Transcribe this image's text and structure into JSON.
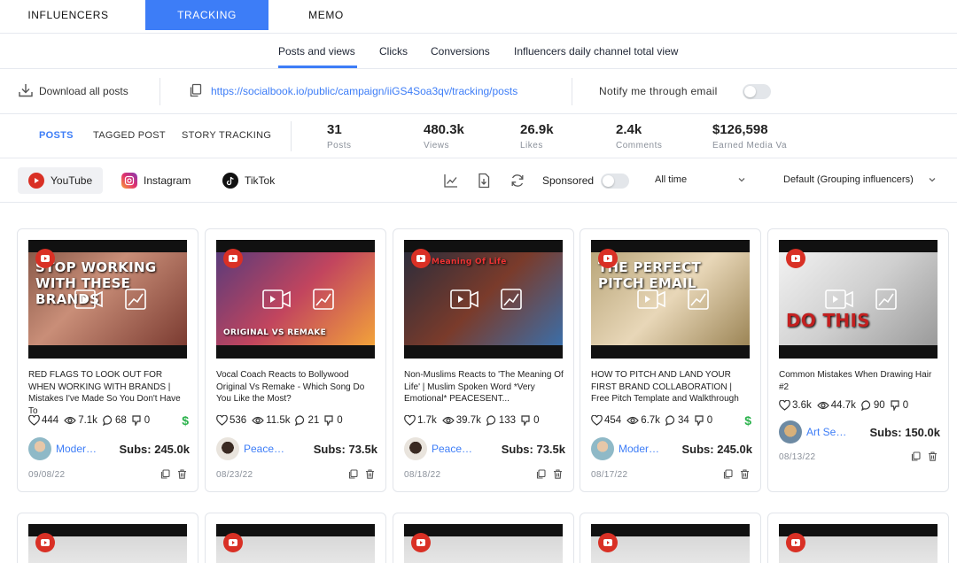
{
  "top_tabs": [
    "INFLUENCERS",
    "TRACKING",
    "MEMO"
  ],
  "sub_tabs": [
    "Posts and views",
    "Clicks",
    "Conversions",
    "Influencers daily channel total view"
  ],
  "link_row": {
    "download_label": "Download all posts",
    "url": "https://socialbook.io/public/campaign/iiGS4Soa3qv/tracking/posts",
    "notify_label": "Notify me through email"
  },
  "post_tabs": [
    "POSTS",
    "TAGGED POST",
    "STORY TRACKING"
  ],
  "stats": [
    {
      "value": "31",
      "label": "Posts"
    },
    {
      "value": "480.3k",
      "label": "Views"
    },
    {
      "value": "26.9k",
      "label": "Likes"
    },
    {
      "value": "2.4k",
      "label": "Comments"
    },
    {
      "value": "$126,598",
      "label": "Earned Media Va"
    }
  ],
  "platforms": [
    "YouTube",
    "Instagram",
    "TikTok"
  ],
  "filters": {
    "sponsored_label": "Sponsored",
    "time_range": "All time",
    "grouping": "Default (Grouping influencers)"
  },
  "colors": {
    "accent": "#3d7df7",
    "youtube": "#d93025",
    "sponsored": "#2bb24c"
  },
  "cards": [
    {
      "thumb_text": "STOP WORKING WITH THESE BRANDS",
      "title": "RED FLAGS TO LOOK OUT FOR WHEN WORKING WITH BRANDS | Mistakes I've Made So You Don't Have To",
      "likes": "444",
      "views": "7.1k",
      "comments": "68",
      "dislikes": "0",
      "sponsored": "$",
      "influencer": "Modern...",
      "subs": "Subs: 245.0k",
      "date": "09/08/22"
    },
    {
      "thumb_text": "ORIGINAL VS REMAKE",
      "title": "Vocal Coach Reacts to Bollywood Original Vs Remake - Which Song Do You Like the Most?",
      "likes": "536",
      "views": "11.5k",
      "comments": "21",
      "dislikes": "0",
      "sponsored": "",
      "influencer": "Peacese...",
      "subs": "Subs: 73.5k",
      "date": "08/23/22"
    },
    {
      "thumb_text": "The Meaning Of Life",
      "title": "Non-Muslims Reacts to 'The Meaning Of Life' | Muslim Spoken Word *Very Emotional* PEACESENT...",
      "likes": "1.7k",
      "views": "39.7k",
      "comments": "133",
      "dislikes": "0",
      "sponsored": "",
      "influencer": "Peacese...",
      "subs": "Subs: 73.5k",
      "date": "08/18/22"
    },
    {
      "thumb_text": "THE PERFECT PITCH EMAIL",
      "title": "HOW TO PITCH AND LAND YOUR FIRST BRAND COLLABORATION | Free Pitch Template and Walkthrough",
      "likes": "454",
      "views": "6.7k",
      "comments": "34",
      "dislikes": "0",
      "sponsored": "$",
      "influencer": "Modern...",
      "subs": "Subs: 245.0k",
      "date": "08/17/22"
    },
    {
      "thumb_text": "DO THIS",
      "title": "Common Mistakes When Drawing Hair #2",
      "likes": "3.6k",
      "views": "44.7k",
      "comments": "90",
      "dislikes": "0",
      "sponsored": "",
      "influencer": "Art Senp...",
      "subs": "Subs: 150.0k",
      "date": "08/13/22"
    }
  ]
}
